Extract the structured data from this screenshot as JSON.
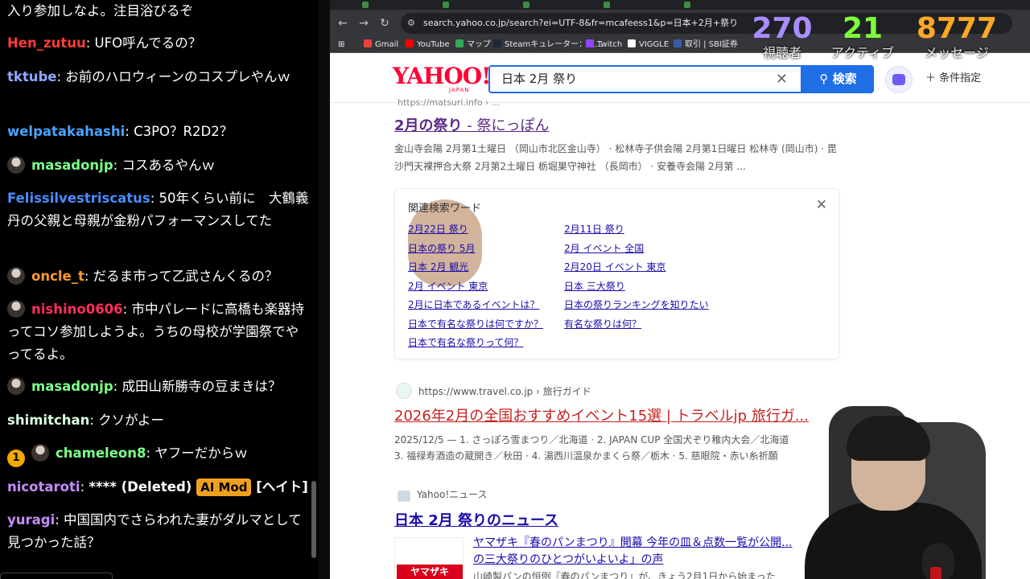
{
  "chat": {
    "messages": [
      {
        "user": "",
        "user_color": "#ffffff",
        "text": "入り参加しなよ。注目浴びるぞ",
        "avatar": false
      },
      {
        "user": "Hen_zutuu",
        "user_color": "#ff3b3b",
        "text": ": UFO呼んでるの？",
        "avatar": false
      },
      {
        "user": "tktube",
        "user_color": "#8fa8ff",
        "text": ": お前のハロウィーンのコスプレやんｗ",
        "avatar": false
      },
      {
        "user": "welpatakahashi",
        "user_color": "#4aa3ff",
        "text": ": C3PO？R2D2？",
        "avatar": false
      },
      {
        "user": "masadonjp",
        "user_color": "#7cff8a",
        "text": ": コスあるやんｗ",
        "avatar": true
      },
      {
        "user": "Felissilvestriscatus",
        "user_color": "#4a8cff",
        "text": ": 50年くらい前に　大鶴義丹の父親と母親が金粉パフォーマンスしてた",
        "avatar": false
      },
      {
        "user": "oncle_t",
        "user_color": "#ff9a2e",
        "text": ": だるま市って乙武さんくるの？",
        "avatar": true
      },
      {
        "user": "nishino0606",
        "user_color": "#ff2e5a",
        "text": ": 市中パレードに高橋も楽器持ってコソ参加しようよ。うちの母校が学園祭でやってるよ。",
        "avatar": true
      },
      {
        "user": "masadonjp",
        "user_color": "#7cff8a",
        "text": ": 成田山新勝寺の豆まきは？",
        "avatar": true
      },
      {
        "user": "shimitchan",
        "user_color": "#d6ffe0",
        "text": ": クソがよー",
        "avatar": false
      },
      {
        "user": "chameleon8",
        "user_color": "#7cff8a",
        "text": ": ヤフーだからｗ",
        "avatar": true,
        "badge": "1"
      },
      {
        "user": "nicotaroti",
        "user_color": "#c58cff",
        "text": ": ",
        "deleted": "**** (Deleted)",
        "mod": "AI Mod",
        "tag": "[ヘイト]",
        "avatar": false
      },
      {
        "user": "yuragi",
        "user_color": "#c58cff",
        "text": ": 中国国内でさらわれた妻がダルマとして見つかった話？",
        "avatar": false
      }
    ]
  },
  "browser": {
    "url": "search.yahoo.co.jp/search?ei=UTF-8&fr=mcafeess1&p=日本+2月+祭り",
    "bookmarks": [
      "Gmail",
      "YouTube",
      "マップ",
      "Steamキュレーター：収...",
      "Twitch",
      "VIGGLE",
      "取引 | SBI証券"
    ]
  },
  "yahoo": {
    "logo": "YAHOO!",
    "logo_sub": "JAPAN",
    "query": "日本 2月 祭り",
    "search_button": "検索",
    "conditions": "条件指定"
  },
  "results": {
    "r1_url": "https://matsuri.info › ...",
    "r1_title_bold": "2月の祭り",
    "r1_title_rest": " - 祭にっぽん",
    "r1_snippet": "金山寺会陽 2月第1土曜日 （岡山市北区金山寺） · 松林寺子供会陽 2月第1日曜日 松林寺 (岡山市) · 毘沙門天裸押合大祭 2月第2土曜日 栃堀巣守神社 （長岡市） · 安養寺会陽 2月第 ...",
    "related_head": "関連検索ワード",
    "related_left": [
      "2月22日 祭り",
      "日本の祭り 5月",
      "日本 2月 観光",
      "2月 イベント 東京",
      "2月に日本であるイベントは？",
      "日本で有名な祭りは何ですか？",
      "日本で有名な祭りって何？"
    ],
    "related_right": [
      "2月11日 祭り",
      "2月 イベント 全国",
      "2月20日 イベント 東京",
      "日本 三大祭り",
      "日本の祭りランキングを知りたい",
      "有名な祭りは何？"
    ],
    "r2_url": "https://www.travel.co.jp › 旅行ガイド",
    "r2_title": "2026年2月の全国おすすめイベント15選 | トラベルjp 旅行ガ...",
    "r2_snip1": "2025/12/5 — 1. さっぽろ雪まつり／北海道 · 2. JAPAN CUP 全国犬ぞり稚内大会／北海道",
    "r2_snip2": "3. 福禄寿酒造の蔵開き／秋田 · 4. 湯西川温泉かまくら祭／栃木 · 5. 慈眼院・赤い糸祈願",
    "r3_source": "Yahoo!ニュース",
    "r3_title": "日本 2月 祭りのニュース",
    "news_title1": "ヤマザキ『春のパンまつり』開幕 今年の皿＆点数一覧が公開...",
    "news_title2": "の三大祭りのひとつがいよいよ」の声",
    "news_snip": "山崎製パンの恒例『春のパンまつり』が、きょう2月1日から始まった",
    "news_logo": "ヤマザキ"
  },
  "stats": [
    {
      "value": "270",
      "label": "視聴者",
      "color": "#a98cff"
    },
    {
      "value": "21",
      "label": "アクティブ",
      "color": "#7cff3a"
    },
    {
      "value": "8777",
      "label": "メッセージ",
      "color": "#ffa726"
    }
  ]
}
